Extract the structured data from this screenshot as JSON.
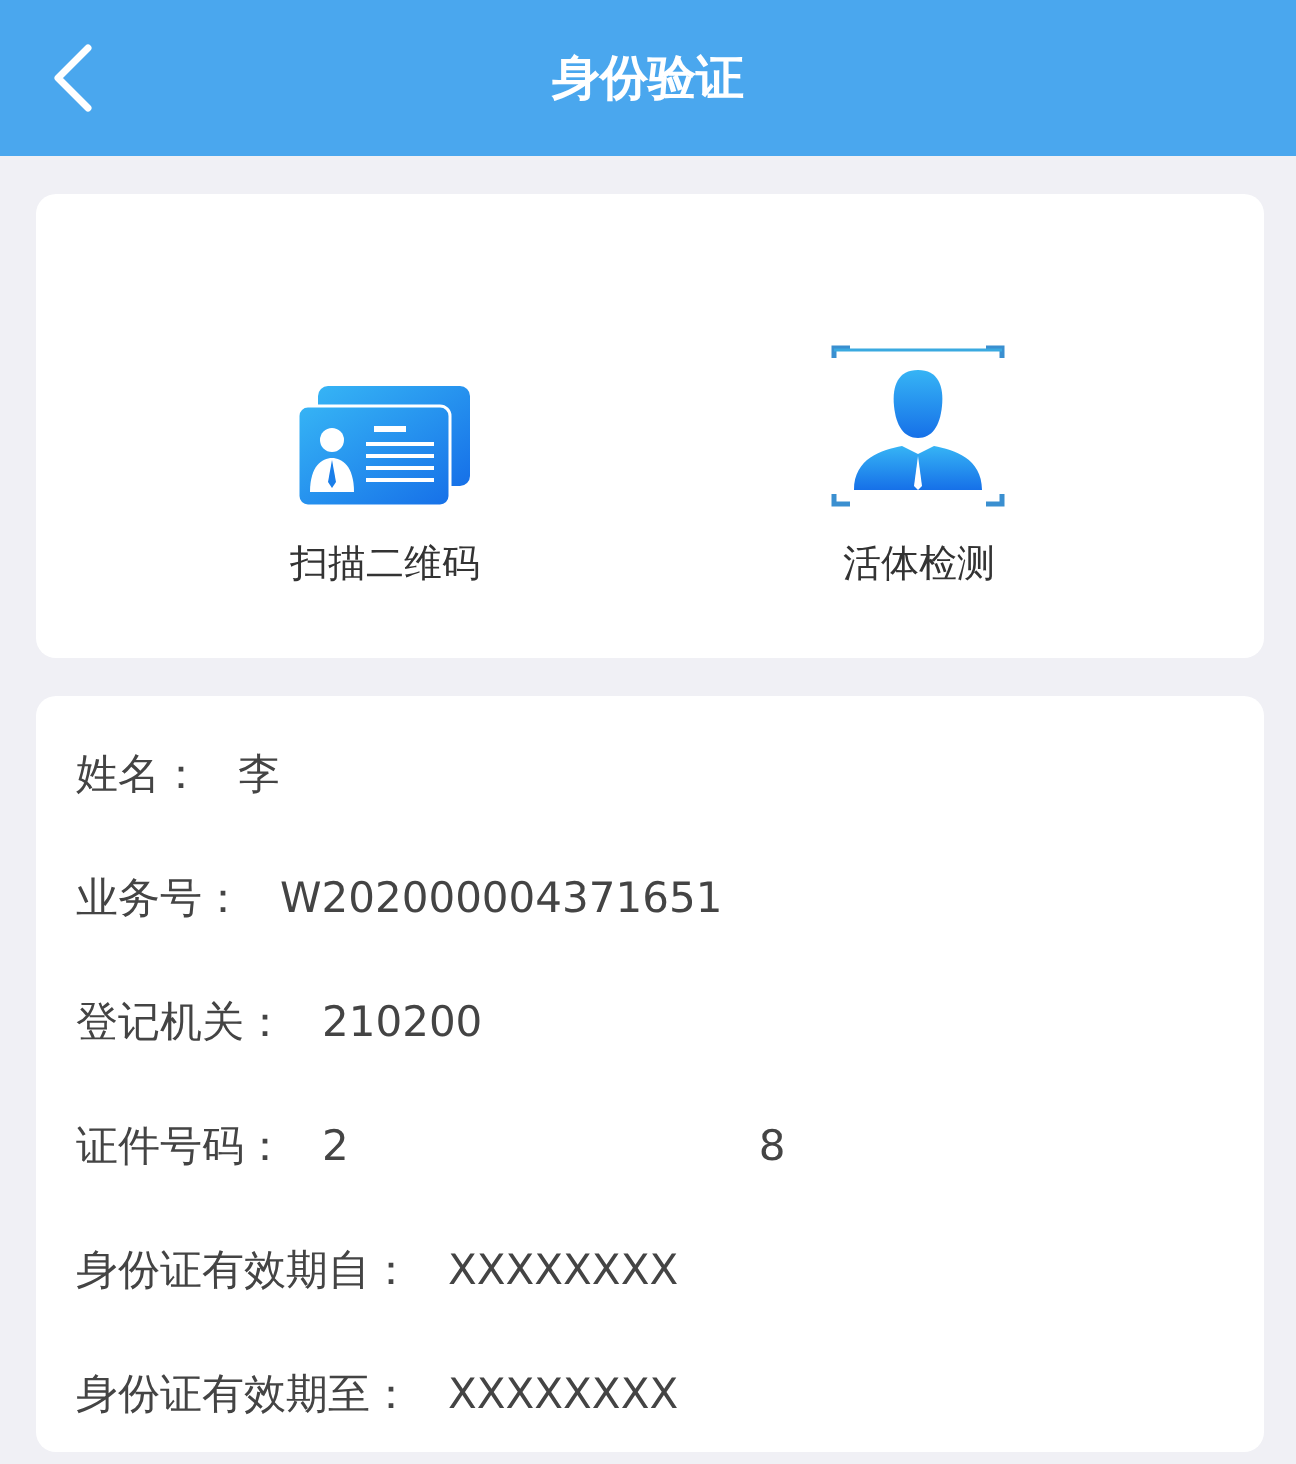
{
  "header": {
    "title": "身份验证"
  },
  "actions": [
    {
      "kind": "card",
      "label": "扫描二维码"
    },
    {
      "kind": "face",
      "label": "活体检测"
    }
  ],
  "fields": [
    {
      "label": "姓名：",
      "values": [
        "李"
      ]
    },
    {
      "label": "业务号：",
      "values": [
        "W202000004371651"
      ]
    },
    {
      "label": "登记机关：",
      "values": [
        "210200"
      ]
    },
    {
      "label": "证件号码：",
      "values": [
        "2",
        "8"
      ]
    },
    {
      "label": "身份证有效期自：",
      "values": [
        "XXXXXXXX"
      ]
    },
    {
      "label": "身份证有效期至：",
      "values": [
        "XXXXXXXX"
      ]
    }
  ]
}
